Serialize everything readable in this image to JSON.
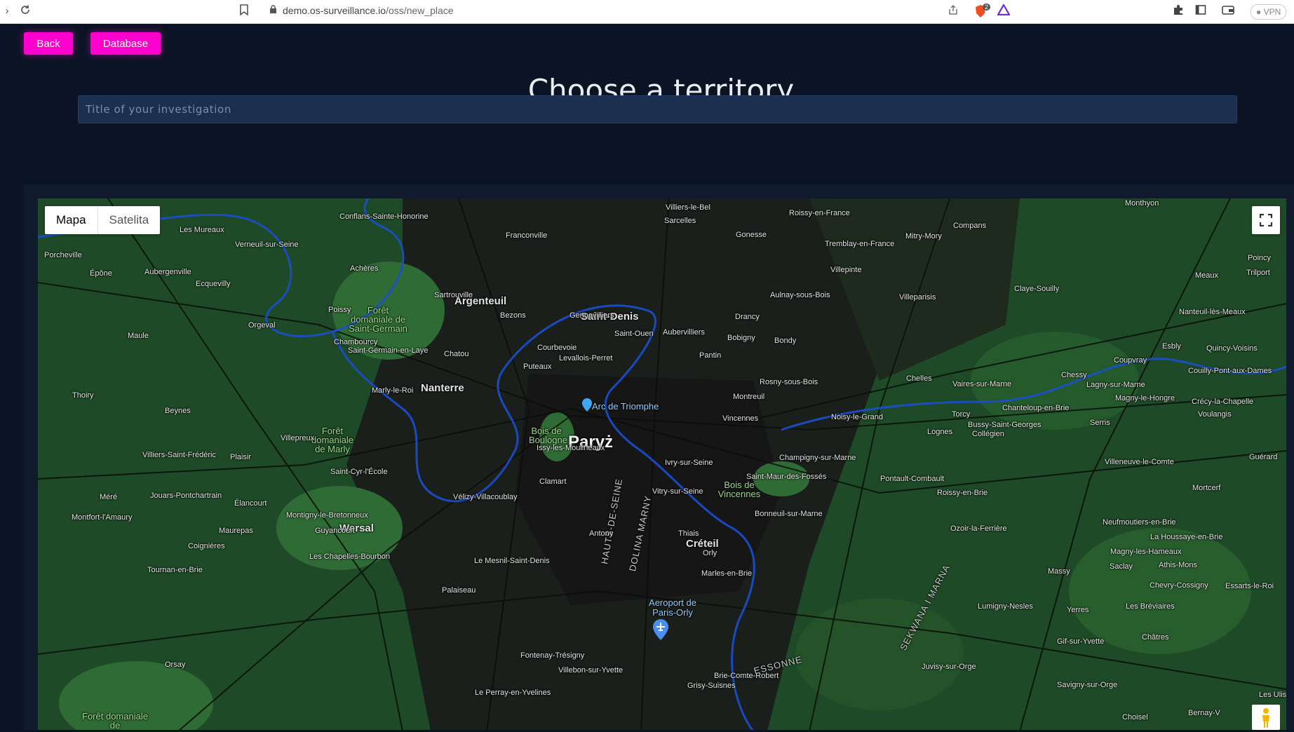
{
  "browser": {
    "url_domain": "demo.os-surveillance.io",
    "url_path": "/oss/new_place",
    "vpn_label": "VPN",
    "brave_badge": "2"
  },
  "nav": {
    "back_label": "Back",
    "database_label": "Database"
  },
  "page": {
    "title": "Choose a territory",
    "input_placeholder": "Title of your investigation",
    "input_value": ""
  },
  "map": {
    "type_tabs": [
      "Mapa",
      "Satelita"
    ],
    "active_tab": "Mapa",
    "city_label": "Paryż",
    "major_labels": [
      "Argenteuil",
      "Saint-Denis",
      "Nanterre",
      "Wersal",
      "Créteil"
    ],
    "poi_labels": [
      "Arc de Triomphe",
      "Aeroport de Paris-Orly"
    ],
    "park_labels": [
      "Forêt domaniale de Saint-Germain",
      "Forêt domaniale de Marly",
      "Bois de Boulogne",
      "Bois de Vincennes",
      "Forêt domaniale de"
    ],
    "region_labels": [
      "HAUTS-DE-SEINE",
      "DOLINA MARNY",
      "ESSONNE",
      "SEKWANA I MARNA"
    ],
    "town_labels": [
      "Villiers-le-Bel",
      "Roissy-en-France",
      "Monthyon",
      "Conflans-Sainte-Honorine",
      "Sarcelles",
      "Les Mureaux",
      "Franconville",
      "Gonesse",
      "Tremblay-en-France",
      "Mitry-Mory",
      "Compans",
      "Verneuil-sur-Seine",
      "Porcheville",
      "Villepinte",
      "Poincy",
      "Meaux",
      "Trilport",
      "Épône",
      "Aubergenville",
      "Achères",
      "Ecquevilly",
      "Claye-Souilly",
      "Sartrouville",
      "Aulnay-sous-Bois",
      "Villeparisis",
      "Poissy",
      "Bezons",
      "Gennevilliers",
      "Drancy",
      "Nanteuil-lès-Meaux",
      "Orgeval",
      "Chambourcy",
      "Saint-Ouen",
      "Aubervilliers",
      "Bobigny",
      "Bondy",
      "Maule",
      "Saint-Germain-en-Laye",
      "Chatou",
      "Courbevoie",
      "Levallois-Perret",
      "Pantin",
      "Esbly",
      "Quincy-Voisins",
      "Puteaux",
      "Rosny-sous-Bois",
      "Coupvray",
      "Couilly-Pont-aux-Dames",
      "Chelles",
      "Vaires-sur-Marne",
      "Chessy",
      "Lagny-sur-Marne",
      "Thoiry",
      "Marly-le-Roi",
      "Montreuil",
      "Magny-le-Hongre",
      "Crécy-la-Chapelle",
      "Beynes",
      "Chanteloup-en-Brie",
      "Noisy-le-Grand",
      "Vincennes",
      "Torcy",
      "Bussy-Saint-Georges",
      "Voulangis",
      "Serris",
      "Villepreux",
      "Lognes",
      "Collégien",
      "Villiers-Saint-Frédéric",
      "Plaisir",
      "Issy-les-Moulineaux",
      "Ivry-sur-Seine",
      "Champigny-sur-Marne",
      "Villeneuve-le-Comte",
      "Guérard",
      "Saint-Cyr-l'École",
      "Clamart",
      "Saint-Maur-des-Fossés",
      "Pontault-Combault",
      "Vitry-sur-Seine",
      "Roissy-en-Brie",
      "Méré",
      "Jouars-Pontchartrain",
      "Vélizy-Villacoublay",
      "Mortcerf",
      "Élancourt",
      "Montigny-le-Bretonneux",
      "Bonneuil-sur-Marne",
      "Montfort-l'Amaury",
      "Neufmoutiers-en-Brie",
      "Maurepas",
      "Guyancourt",
      "Antony",
      "Thiais",
      "Ozoir-la-Ferrière",
      "La Houssaye-en-Brie",
      "Coignières",
      "Orly",
      "Magny-les-Hameaux",
      "Les Chapelles-Bourbon",
      "Le Mesnil-Saint-Denis",
      "Saclay",
      "Tournan-en-Brie",
      "Marles-en-Brie",
      "Massy",
      "Chevry-Cossigny",
      "Essarts-le-Roi",
      "Palaiseau",
      "Athis-Mons",
      "Yerres",
      "Lumigny-Nesles",
      "Les Bréviaires",
      "Châtres",
      "Fontenay-Trésigny",
      "Gif-sur-Yvette",
      "Orsay",
      "Villebon-sur-Yvette",
      "Le Perray-en-Yvelines",
      "Juvisy-sur-Orge",
      "Brie-Comte-Robert",
      "Choisel",
      "Savigny-sur-Orge",
      "Grisy-Suisnes",
      "Les Ulis",
      "Bernay-V"
    ]
  },
  "colors": {
    "accent": "#ff00cf",
    "background": "#0b1424",
    "input_bg": "#1b2f4f"
  }
}
